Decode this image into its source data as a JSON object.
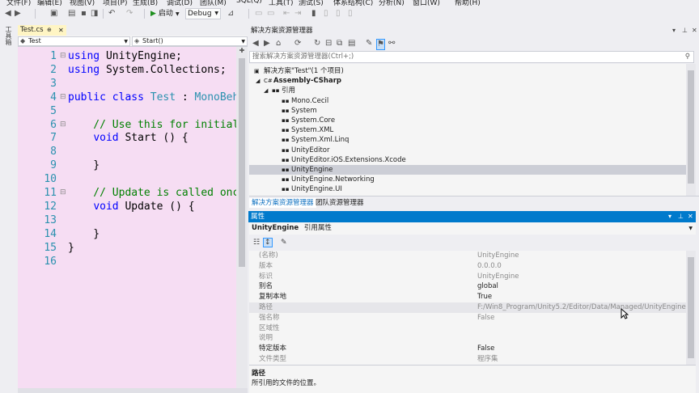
{
  "menubar": {
    "items": [
      "文件(F)",
      "编辑(E)",
      "视图(V)",
      "项目(P)",
      "生成(B)",
      "调试(D)",
      "团队(M)",
      "SQL(Q)",
      "工具(T)",
      "测试(S)",
      "体系结构(C)",
      "分析(N)",
      "窗口(W)",
      "帮助(H)"
    ]
  },
  "toolbar": {
    "start_label": "启动",
    "config_value": "Debug"
  },
  "left_strip": {
    "label": "工具箱"
  },
  "editor": {
    "tab_label": "Test.cs",
    "nav_left": "Test",
    "nav_right": "Start()",
    "line_numbers": [
      "1",
      "2",
      "3",
      "4",
      "5",
      "6",
      "7",
      "8",
      "9",
      "10",
      "11",
      "12",
      "13",
      "14",
      "15",
      "16"
    ],
    "lines": [
      [
        {
          "t": "using ",
          "c": "kw"
        },
        {
          "t": "UnityEngine;",
          "c": ""
        }
      ],
      [
        {
          "t": "using ",
          "c": "kw"
        },
        {
          "t": "System.Collections;",
          "c": ""
        }
      ],
      [],
      [
        {
          "t": "public class ",
          "c": "kw"
        },
        {
          "t": "Test",
          "c": "ty"
        },
        {
          "t": " : ",
          "c": ""
        },
        {
          "t": "MonoBeha",
          "c": "ty"
        }
      ],
      [],
      [
        {
          "t": "    // Use this for initiali",
          "c": "cm"
        }
      ],
      [
        {
          "t": "    ",
          "c": ""
        },
        {
          "t": "void",
          "c": "kw"
        },
        {
          "t": " Start () {",
          "c": ""
        }
      ],
      [],
      [
        {
          "t": "    }",
          "c": ""
        }
      ],
      [],
      [
        {
          "t": "    // Update is called once",
          "c": "cm"
        }
      ],
      [
        {
          "t": "    ",
          "c": ""
        },
        {
          "t": "void",
          "c": "kw"
        },
        {
          "t": " Update () {",
          "c": ""
        }
      ],
      [],
      [
        {
          "t": "    }",
          "c": ""
        }
      ],
      [
        {
          "t": "}",
          "c": ""
        }
      ],
      []
    ]
  },
  "solution_explorer": {
    "title": "解决方案资源管理器",
    "search_placeholder": "搜索解决方案资源管理器(Ctrl+;)",
    "tree": [
      {
        "label": "解决方案\"Test\"(1 个项目)",
        "indent": 0,
        "icon": "solution-icon",
        "bold": false,
        "selected": false
      },
      {
        "label": "Assembly-CSharp",
        "indent": 1,
        "icon": "csharp-project-icon",
        "bold": true,
        "selected": false
      },
      {
        "label": "引用",
        "indent": 2,
        "icon": "references-icon",
        "bold": false,
        "selected": false
      },
      {
        "label": "Mono.Cecil",
        "indent": 3,
        "icon": "reference-icon",
        "bold": false,
        "selected": false
      },
      {
        "label": "System",
        "indent": 3,
        "icon": "reference-icon",
        "bold": false,
        "selected": false
      },
      {
        "label": "System.Core",
        "indent": 3,
        "icon": "reference-icon",
        "bold": false,
        "selected": false
      },
      {
        "label": "System.XML",
        "indent": 3,
        "icon": "reference-icon",
        "bold": false,
        "selected": false
      },
      {
        "label": "System.Xml.Linq",
        "indent": 3,
        "icon": "reference-icon",
        "bold": false,
        "selected": false
      },
      {
        "label": "UnityEditor",
        "indent": 3,
        "icon": "reference-icon",
        "bold": false,
        "selected": false
      },
      {
        "label": "UnityEditor.iOS.Extensions.Xcode",
        "indent": 3,
        "icon": "reference-icon",
        "bold": false,
        "selected": false
      },
      {
        "label": "UnityEngine",
        "indent": 3,
        "icon": "reference-icon",
        "bold": false,
        "selected": true
      },
      {
        "label": "UnityEngine.Networking",
        "indent": 3,
        "icon": "reference-icon",
        "bold": false,
        "selected": false
      },
      {
        "label": "UnityEngine.UI",
        "indent": 3,
        "icon": "reference-icon",
        "bold": false,
        "selected": false
      }
    ],
    "tabs": [
      "解决方案资源管理器",
      "团队资源管理器"
    ]
  },
  "properties": {
    "title": "属性",
    "object_name": "UnityEngine",
    "object_kind": "引用属性",
    "rows": [
      {
        "name": "(名称)",
        "value": "UnityEngine",
        "readonly": true,
        "highlight": false
      },
      {
        "name": "版本",
        "value": "0.0.0.0",
        "readonly": true,
        "highlight": false
      },
      {
        "name": "标识",
        "value": "UnityEngine",
        "readonly": true,
        "highlight": false
      },
      {
        "name": "别名",
        "value": "global",
        "readonly": false,
        "highlight": false
      },
      {
        "name": "复制本地",
        "value": "True",
        "readonly": false,
        "highlight": false
      },
      {
        "name": "路径",
        "value": "F:/Win8_Program/Unity5.2/Editor/Data/Managed/UnityEngine.dll",
        "readonly": true,
        "highlight": true
      },
      {
        "name": "强名称",
        "value": "False",
        "readonly": true,
        "highlight": false
      },
      {
        "name": "区域性",
        "value": "",
        "readonly": true,
        "highlight": false
      },
      {
        "name": "说明",
        "value": "",
        "readonly": true,
        "highlight": false
      },
      {
        "name": "特定版本",
        "value": "False",
        "readonly": false,
        "highlight": false
      },
      {
        "name": "文件类型",
        "value": "程序集",
        "readonly": true,
        "highlight": false
      }
    ],
    "desc_title": "路径",
    "desc_text": "所引用的文件的位置。"
  }
}
